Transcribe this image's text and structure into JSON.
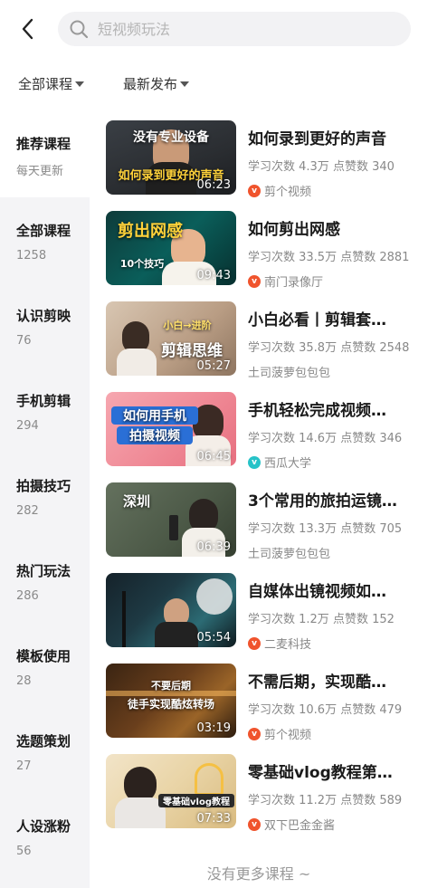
{
  "search": {
    "placeholder": "短视频玩法"
  },
  "filters": {
    "category": "全部课程",
    "sort": "最新发布"
  },
  "sidebar": {
    "top": {
      "label": "推荐课程",
      "sub": "每天更新"
    },
    "items": [
      {
        "label": "全部课程",
        "count": "1258"
      },
      {
        "label": "认识剪映",
        "count": "76"
      },
      {
        "label": "手机剪辑",
        "count": "294"
      },
      {
        "label": "拍摄技巧",
        "count": "282"
      },
      {
        "label": "热门玩法",
        "count": "286"
      },
      {
        "label": "模板使用",
        "count": "28"
      },
      {
        "label": "选题策划",
        "count": "27"
      },
      {
        "label": "人设涨粉",
        "count": "56"
      }
    ]
  },
  "courses": [
    {
      "title": "如何录到更好的声音",
      "stats": "学习次数 4.3万 点赞数 340",
      "author": "剪个视频",
      "duration": "06:23",
      "thumb_text": "没有专业设备",
      "thumb_text2": "如何录到更好的声音",
      "badge_color": "#f0542d"
    },
    {
      "title": "如何剪出网感",
      "stats": "学习次数 33.5万 点赞数 2881",
      "author": "南门录像厅",
      "duration": "09:43",
      "thumb_text": "剪出网感",
      "thumb_text2": "10个技巧",
      "badge_color": "#f0542d"
    },
    {
      "title": "小白必看丨剪辑套…",
      "stats": "学习次数 35.8万 点赞数 2548",
      "author": "土司菠萝包包包",
      "duration": "05:27",
      "thumb_text": "剪辑思维",
      "thumb_text2": "小白→进阶",
      "badge_color": ""
    },
    {
      "title": "手机轻松完成视频…",
      "stats": "学习次数 14.6万 点赞数 346",
      "author": "西瓜大学",
      "duration": "06:45",
      "thumb_text": "如何用手机",
      "thumb_text2": "拍摄视频",
      "badge_color": "#27c3c8"
    },
    {
      "title": "3个常用的旅拍运镜…",
      "stats": "学习次数 13.3万 点赞数 705",
      "author": "土司菠萝包包包",
      "duration": "06:39",
      "thumb_text": "深圳",
      "thumb_text2": "",
      "badge_color": ""
    },
    {
      "title": "自媒体出镜视频如…",
      "stats": "学习次数 1.2万 点赞数 152",
      "author": "二麦科技",
      "duration": "05:54",
      "thumb_text": "",
      "thumb_text2": "",
      "badge_color": "#f0542d"
    },
    {
      "title": "不需后期，实现酷…",
      "stats": "学习次数 10.6万 点赞数 479",
      "author": "剪个视频",
      "duration": "03:19",
      "thumb_text": "不要后期",
      "thumb_text2": "徒手实现酷炫转场",
      "badge_color": "#f0542d"
    },
    {
      "title": "零基础vlog教程第…",
      "stats": "学习次数 11.2万 点赞数 589",
      "author": "双下巴金金酱",
      "duration": "07:33",
      "thumb_text": "零基础vlog教程",
      "thumb_text2": "",
      "badge_color": "#f0542d"
    }
  ],
  "footer": {
    "text": "没有更多课程 ~"
  }
}
